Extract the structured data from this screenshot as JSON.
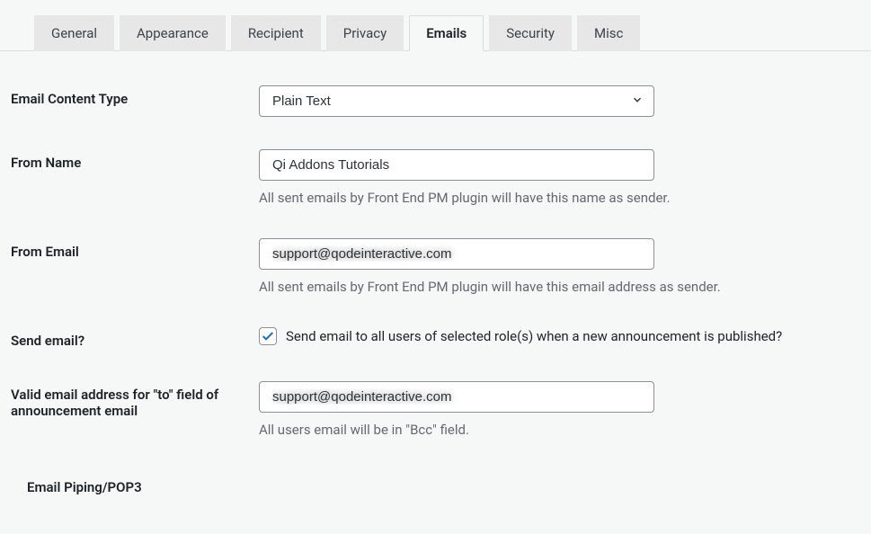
{
  "tabs": [
    {
      "label": "General"
    },
    {
      "label": "Appearance"
    },
    {
      "label": "Recipient"
    },
    {
      "label": "Privacy"
    },
    {
      "label": "Emails"
    },
    {
      "label": "Security"
    },
    {
      "label": "Misc"
    }
  ],
  "activeTab": "Emails",
  "fields": {
    "emailContentType": {
      "label": "Email Content Type",
      "value": "Plain Text"
    },
    "fromName": {
      "label": "From Name",
      "value": "Qi Addons Tutorials",
      "description": "All sent emails by Front End PM plugin will have this name as sender."
    },
    "fromEmail": {
      "label": "From Email",
      "value": "support@qodeinteractive.com",
      "description": "All sent emails by Front End PM plugin will have this email address as sender."
    },
    "sendEmail": {
      "label": "Send email?",
      "checked": true,
      "checkboxLabel": "Send email to all users of selected role(s) when a new announcement is published?"
    },
    "validEmail": {
      "label": "Valid email address for \"to\" field of announcement email",
      "value": "support@qodeinteractive.com",
      "description": "All users email will be in \"Bcc\" field."
    }
  },
  "sectionHeading": "Email Piping/POP3"
}
